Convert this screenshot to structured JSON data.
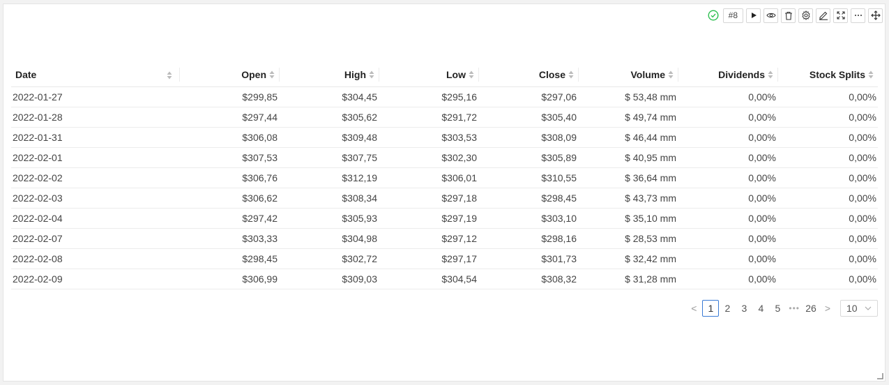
{
  "toolbar": {
    "status_icon": "check-circle-icon",
    "badge": "#8",
    "buttons": [
      "play-icon",
      "eye-icon",
      "trash-icon",
      "gear-icon",
      "edit-icon",
      "fullscreen-icon",
      "more-icon",
      "move-icon"
    ],
    "status_color": "#2bbf4e"
  },
  "table": {
    "columns": [
      "Date",
      "Open",
      "High",
      "Low",
      "Close",
      "Volume",
      "Dividends",
      "Stock Splits"
    ],
    "rows": [
      [
        "2022-01-27",
        "$299,85",
        "$304,45",
        "$295,16",
        "$297,06",
        "$ 53,48 mm",
        "0,00%",
        "0,00%"
      ],
      [
        "2022-01-28",
        "$297,44",
        "$305,62",
        "$291,72",
        "$305,40",
        "$ 49,74 mm",
        "0,00%",
        "0,00%"
      ],
      [
        "2022-01-31",
        "$306,08",
        "$309,48",
        "$303,53",
        "$308,09",
        "$ 46,44 mm",
        "0,00%",
        "0,00%"
      ],
      [
        "2022-02-01",
        "$307,53",
        "$307,75",
        "$302,30",
        "$305,89",
        "$ 40,95 mm",
        "0,00%",
        "0,00%"
      ],
      [
        "2022-02-02",
        "$306,76",
        "$312,19",
        "$306,01",
        "$310,55",
        "$ 36,64 mm",
        "0,00%",
        "0,00%"
      ],
      [
        "2022-02-03",
        "$306,62",
        "$308,34",
        "$297,18",
        "$298,45",
        "$ 43,73 mm",
        "0,00%",
        "0,00%"
      ],
      [
        "2022-02-04",
        "$297,42",
        "$305,93",
        "$297,19",
        "$303,10",
        "$ 35,10 mm",
        "0,00%",
        "0,00%"
      ],
      [
        "2022-02-07",
        "$303,33",
        "$304,98",
        "$297,12",
        "$298,16",
        "$ 28,53 mm",
        "0,00%",
        "0,00%"
      ],
      [
        "2022-02-08",
        "$298,45",
        "$302,72",
        "$297,17",
        "$301,73",
        "$ 32,42 mm",
        "0,00%",
        "0,00%"
      ],
      [
        "2022-02-09",
        "$306,99",
        "$309,03",
        "$304,54",
        "$308,32",
        "$ 31,28 mm",
        "0,00%",
        "0,00%"
      ]
    ]
  },
  "pagination": {
    "prev": "<",
    "next": ">",
    "pages": [
      "1",
      "2",
      "3",
      "4",
      "5"
    ],
    "ellipsis": "•••",
    "last": "26",
    "current": "1",
    "page_size": "10",
    "active_color": "#3a7bd5"
  }
}
